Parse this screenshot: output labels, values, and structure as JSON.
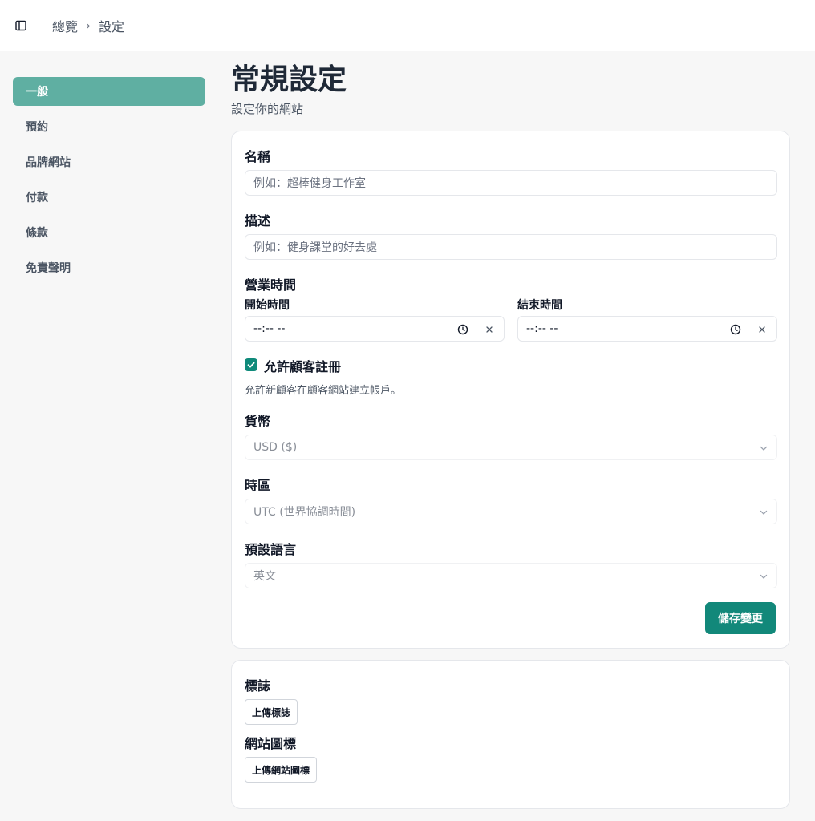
{
  "header": {
    "toggle_icon": "sidebar-toggle-icon",
    "breadcrumb": {
      "parent": "總覽",
      "separator": "›",
      "current": "設定"
    }
  },
  "sidebar": {
    "items": [
      {
        "label": "一般",
        "active": true
      },
      {
        "label": "預約"
      },
      {
        "label": "品牌網站"
      },
      {
        "label": "付款"
      },
      {
        "label": "條款"
      },
      {
        "label": "免責聲明"
      }
    ]
  },
  "page": {
    "title": "常規設定",
    "subtitle": "設定你的網站"
  },
  "general_form": {
    "name": {
      "label": "名稱",
      "placeholder": "例如：超棒健身工作室"
    },
    "description": {
      "label": "描述",
      "placeholder": "例如：健身課堂的好去處"
    },
    "hours": {
      "label": "營業時間",
      "start_label": "開始時間",
      "start_value": "--:-- --",
      "end_label": "結束時間",
      "end_value": "--:-- --"
    },
    "allow_registration": {
      "label": "允許顧客註冊",
      "checked": true,
      "helper": "允許新顧客在顧客網站建立帳戶。"
    },
    "currency": {
      "label": "貨幣",
      "value": "USD ($)"
    },
    "timezone": {
      "label": "時區",
      "value": "UTC (世界協調時間)"
    },
    "language": {
      "label": "預設語言",
      "value": "英文"
    },
    "save_label": "儲存變更"
  },
  "branding": {
    "logo": {
      "label": "標誌",
      "button": "上傳標誌"
    },
    "favicon": {
      "label": "網站圖標",
      "button": "上傳網站圖標"
    }
  },
  "colors": {
    "accent": "#12887a",
    "active_nav": "#5fafa2",
    "checkbox": "#0f8a7a"
  }
}
